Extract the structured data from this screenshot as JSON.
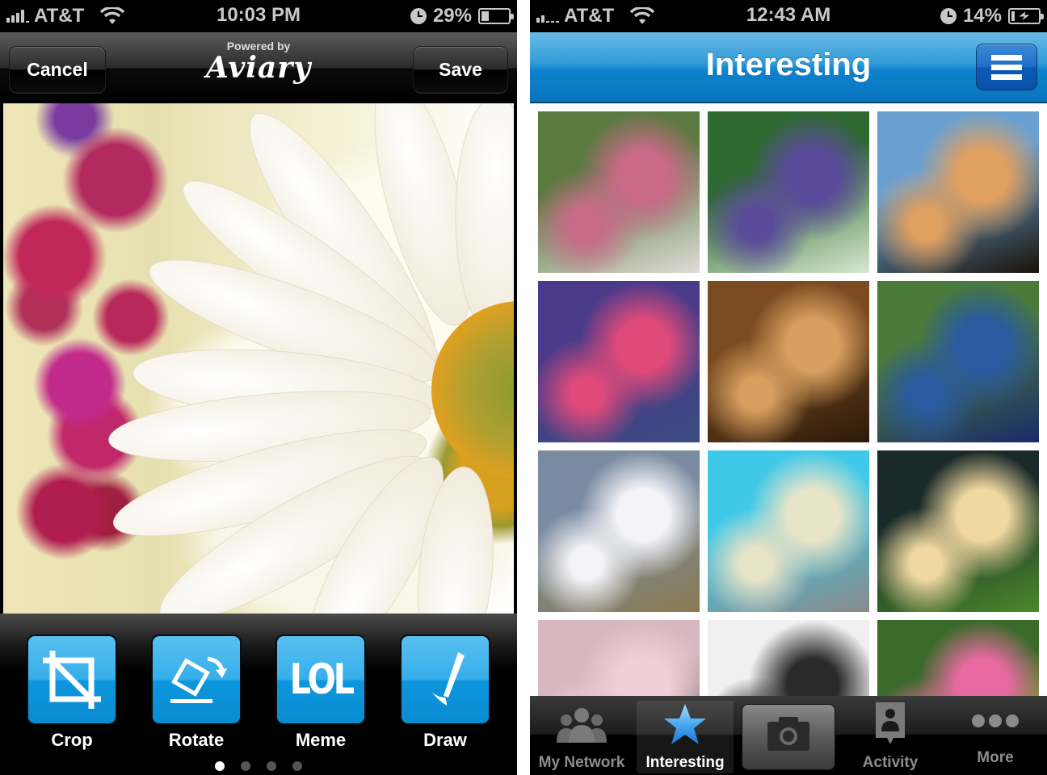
{
  "left_screen": {
    "status_bar": {
      "carrier": "AT&T",
      "signal_bars": 4,
      "time": "10:03 PM",
      "battery_percent_label": "29%",
      "battery_level": 0.29,
      "charging": false
    },
    "nav": {
      "cancel_label": "Cancel",
      "save_label": "Save",
      "powered_by": "Powered by",
      "brand": "Aviary"
    },
    "photo": {
      "subject": "white daisy with pink flowers"
    },
    "tools": [
      {
        "label": "Crop",
        "icon": "crop-icon"
      },
      {
        "label": "Rotate",
        "icon": "rotate-icon"
      },
      {
        "label": "Meme",
        "icon": "meme-lol-icon",
        "icon_text": "LOL"
      },
      {
        "label": "Draw",
        "icon": "draw-pen-icon"
      }
    ],
    "page_indicator": {
      "total": 4,
      "current": 1
    }
  },
  "right_screen": {
    "status_bar": {
      "carrier": "AT&T",
      "signal_bars": 2,
      "time": "12:43 AM",
      "battery_percent_label": "14%",
      "battery_level": 0.14,
      "charging": true
    },
    "nav": {
      "title": "Interesting",
      "menu_icon": "hamburger-menu-icon"
    },
    "photos": [
      {
        "name": "flowering-trees-path",
        "colors": [
          "#5a7a40",
          "#c86a88",
          "#e0dcd8"
        ]
      },
      {
        "name": "purple-berries",
        "colors": [
          "#2e6a30",
          "#5a4a9a",
          "#d8e8d0"
        ]
      },
      {
        "name": "sunset-lake",
        "colors": [
          "#6aa0d0",
          "#e0a060",
          "#1a1208"
        ]
      },
      {
        "name": "pink-sky-beach",
        "colors": [
          "#4a3a8a",
          "#e04a7a",
          "#3a4a80"
        ]
      },
      {
        "name": "cave-stalactites",
        "colors": [
          "#7a4a20",
          "#d8a060",
          "#2a1a0a"
        ]
      },
      {
        "name": "water-pump",
        "colors": [
          "#4a7a3a",
          "#2a5aa0",
          "#1a2a6a"
        ]
      },
      {
        "name": "mount-fuji",
        "colors": [
          "#7a8aa0",
          "#f4f4f8",
          "#8a7a50"
        ]
      },
      {
        "name": "pasta-bowl",
        "colors": [
          "#40c8e8",
          "#e8e4c8",
          "#8a8a88"
        ]
      },
      {
        "name": "soft-serve-matcha",
        "colors": [
          "#1a2a28",
          "#f0d8a0",
          "#4a8a2a"
        ]
      },
      {
        "name": "cherry-blossoms",
        "colors": [
          "#d8b8c0",
          "#f0d0d8",
          "#5a4040"
        ]
      },
      {
        "name": "roller-coaster",
        "colors": [
          "#f0f0f0",
          "#2a2a2a",
          "#d8d8d8"
        ]
      },
      {
        "name": "pink-tulips",
        "colors": [
          "#3a6a2a",
          "#e86aa0",
          "#d8d840"
        ]
      }
    ],
    "tabs": [
      {
        "label": "My Network",
        "icon": "people-icon",
        "selected": false
      },
      {
        "label": "Interesting",
        "icon": "star-icon",
        "selected": true
      },
      {
        "label": "",
        "icon": "camera-icon",
        "selected": false
      },
      {
        "label": "Activity",
        "icon": "activity-badge-icon",
        "selected": false
      },
      {
        "label": "More",
        "icon": "more-dots-icon",
        "selected": false
      }
    ]
  }
}
